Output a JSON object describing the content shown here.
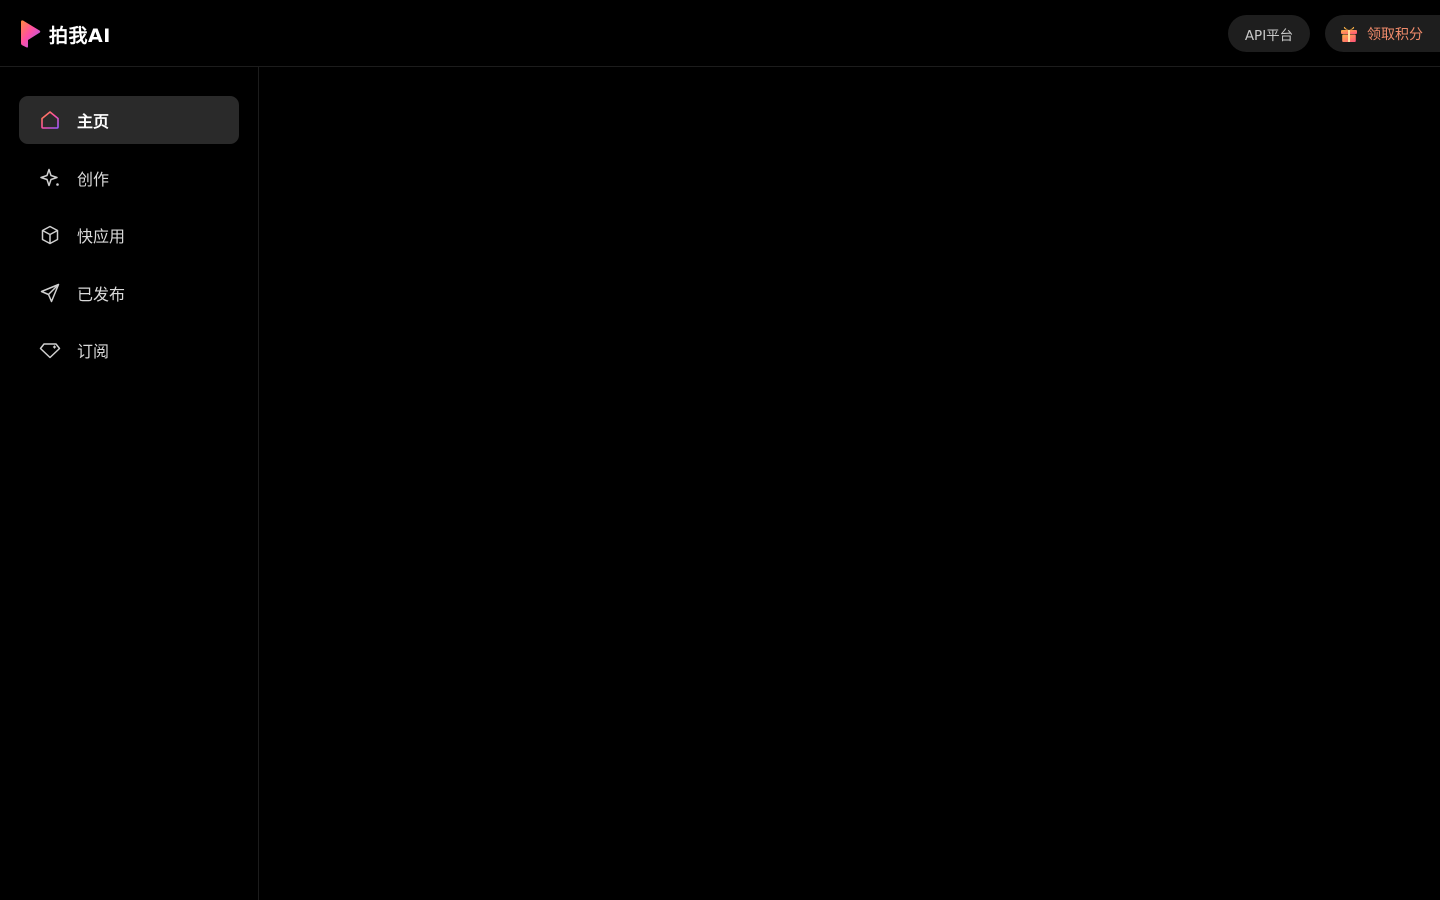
{
  "brand": {
    "name": "拍我AI",
    "logo_icon": "play-logo-icon",
    "logo_colors": [
      "#ff4fa3",
      "#9b5cff",
      "#ff8a3d"
    ]
  },
  "header": {
    "api_button_label": "API平台",
    "points_button_label": "领取积分",
    "points_icon": "gift-icon",
    "points_label_color": "#ef8a6a"
  },
  "sidebar": {
    "items": [
      {
        "label": "主页",
        "icon": "home-icon",
        "active": true
      },
      {
        "label": "创作",
        "icon": "sparkle-icon",
        "active": false
      },
      {
        "label": "快应用",
        "icon": "cube-icon",
        "active": false
      },
      {
        "label": "已发布",
        "icon": "send-icon",
        "active": false
      },
      {
        "label": "订阅",
        "icon": "gem-icon",
        "active": false
      }
    ]
  },
  "colors": {
    "background": "#000000",
    "active_item_bg": "#2a2a2a",
    "button_bg": "#1e1e1e",
    "accent_gradient_start": "#ff4fa3",
    "accent_gradient_end": "#9b5cff"
  }
}
